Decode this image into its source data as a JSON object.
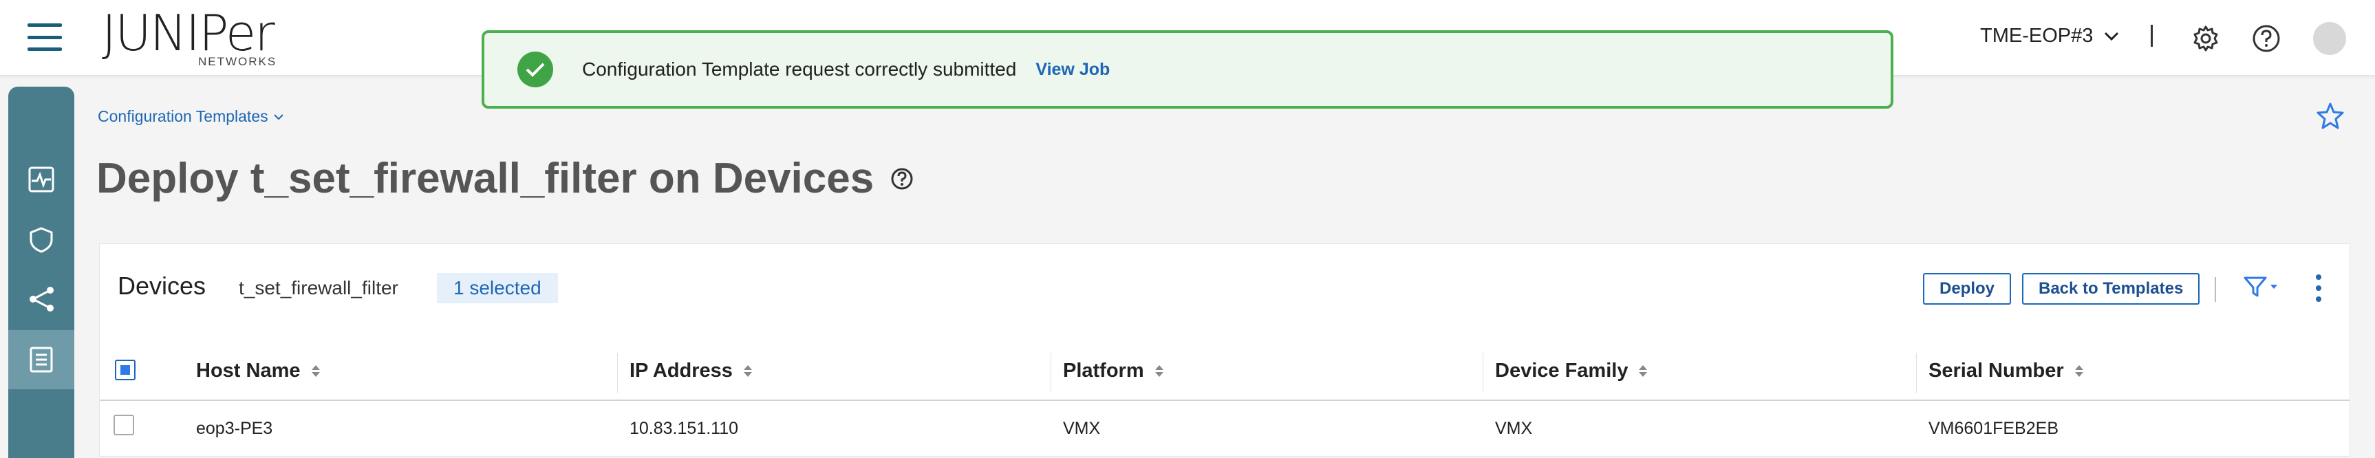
{
  "header": {
    "logo_text": "JUNIPer",
    "logo_sub": "NETWORKS",
    "tenant": "TME-EOP#3",
    "separator": "|"
  },
  "toast": {
    "message": "Configuration Template request correctly submitted",
    "link": "View Job",
    "color": "#4caf50"
  },
  "sidebar": {
    "items": [
      {
        "icon": "monitor-pulse-icon"
      },
      {
        "icon": "shield-icon"
      },
      {
        "icon": "share-nodes-icon"
      },
      {
        "icon": "document-icon",
        "active": true
      }
    ]
  },
  "breadcrumb": {
    "label": "Configuration Templates"
  },
  "page": {
    "title": "Deploy t_set_firewall_filter on Devices"
  },
  "devices_card": {
    "title": "Devices",
    "template_name": "t_set_firewall_filter",
    "selected_badge": "1 selected",
    "deploy_label": "Deploy",
    "back_label": "Back to Templates"
  },
  "table": {
    "columns": [
      "Host Name",
      "IP Address",
      "Platform",
      "Device Family",
      "Serial Number"
    ],
    "rows": [
      {
        "host": "eop3-PE3",
        "ip": "10.83.151.110",
        "platform": "VMX",
        "family": "VMX",
        "serial": "VM6601FEB2EB"
      }
    ]
  },
  "colors": {
    "accent": "#1d67b5",
    "sidebar": "#4a7d8c",
    "success": "#3fa445"
  }
}
